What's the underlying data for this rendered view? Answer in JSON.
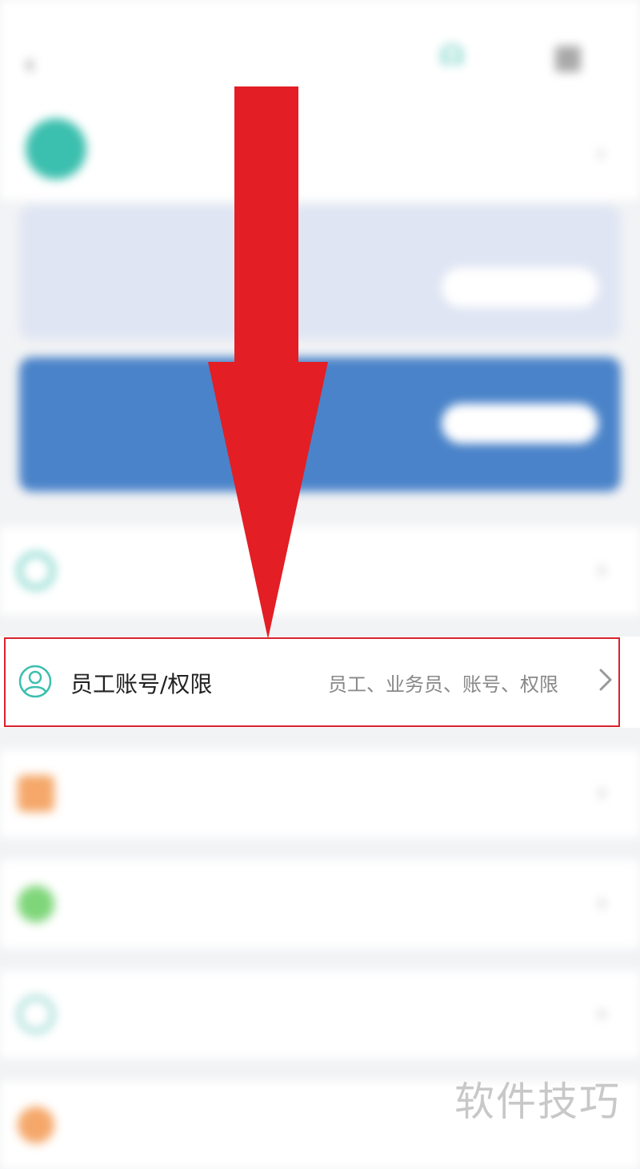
{
  "status_bar": {
    "left": "",
    "center": "",
    "right": ""
  },
  "nav": {
    "back_icon": "chevron-left-icon",
    "title": "",
    "service_label": "",
    "scan_icon": "qr-scan-icon"
  },
  "profile": {
    "phone": "",
    "role": ""
  },
  "trial_card": {
    "title": "",
    "desc": "",
    "button": "",
    "badge": ""
  },
  "promo_card": {
    "title": "",
    "desc": "",
    "button": ""
  },
  "menu": [
    {
      "label": "",
      "sub": "",
      "icon": "switch-icon",
      "color": "#3bbfae"
    },
    {
      "label": "员工账号/权限",
      "sub": "员工、业务员、账号、权限",
      "icon": "person-icon",
      "color": "#3bbfae"
    },
    {
      "label": "",
      "sub": "",
      "icon": "folder-icon",
      "color": "#f5a86a"
    },
    {
      "label": "",
      "sub": "",
      "icon": "settings-icon",
      "color": "#7fd67a"
    },
    {
      "label": "",
      "sub": "",
      "icon": "help-icon",
      "color": "#6fc9c0"
    },
    {
      "label": "",
      "sub": "",
      "icon": "more-icon",
      "color": "#f5a86a"
    }
  ],
  "annotation": {
    "color": "#d8222c"
  },
  "watermark": "软件技巧"
}
